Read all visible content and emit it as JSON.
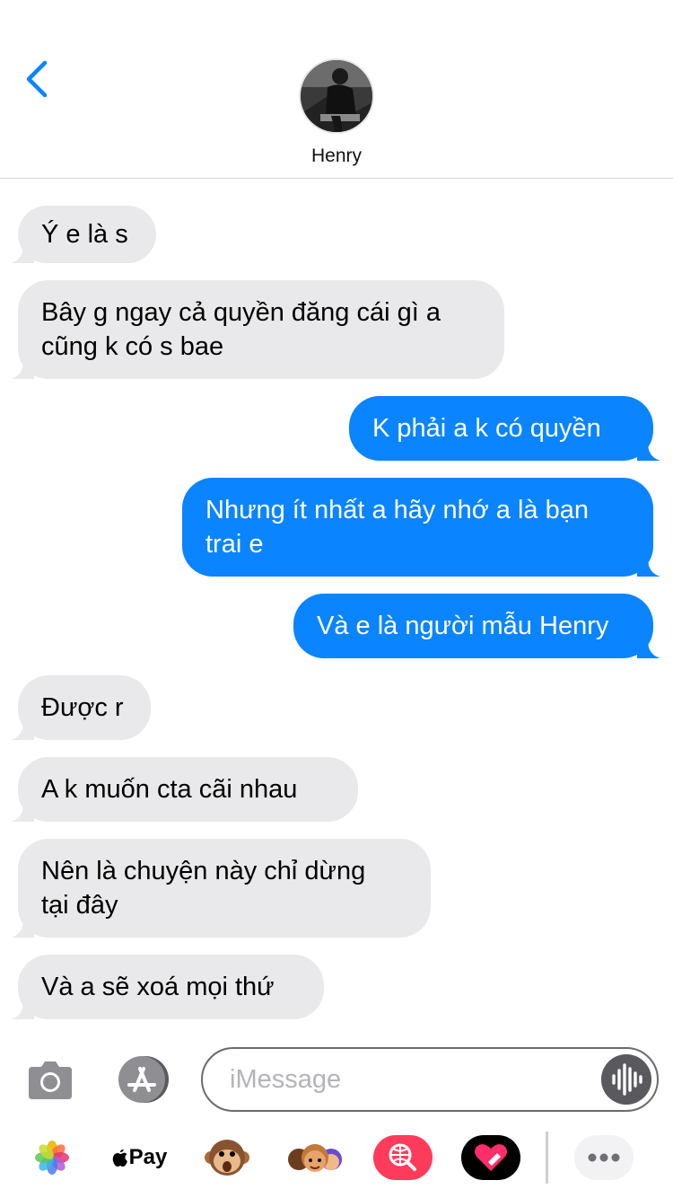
{
  "contact": {
    "name": "Henry"
  },
  "messages": [
    {
      "dir": "in",
      "lines": [
        "Ý e là s"
      ]
    },
    {
      "dir": "in",
      "lines": [
        "Bây g ngay cả quyền đăng cái gì a",
        "cũng k có s bae"
      ]
    },
    {
      "dir": "out",
      "lines": [
        "K phải a k có quyền"
      ]
    },
    {
      "dir": "out",
      "lines": [
        "Nhưng ít nhất a hãy nhớ a là bạn",
        "trai e"
      ]
    },
    {
      "dir": "out",
      "lines": [
        "Và e là người mẫu Henry"
      ]
    },
    {
      "dir": "in",
      "lines": [
        "Được r"
      ]
    },
    {
      "dir": "in",
      "lines": [
        "A k muốn cta cãi nhau"
      ]
    },
    {
      "dir": "in",
      "lines": [
        "Nên là chuyện này chỉ dừng",
        "tại đây"
      ]
    },
    {
      "dir": "in",
      "lines": [
        "Và a sẽ xoá mọi thứ"
      ]
    }
  ],
  "composer": {
    "placeholder": "iMessage",
    "value": ""
  },
  "tray": {
    "applepay_label": "Pay"
  },
  "colors": {
    "accent": "#0a84ff",
    "incoming": "#e9e9eb"
  }
}
